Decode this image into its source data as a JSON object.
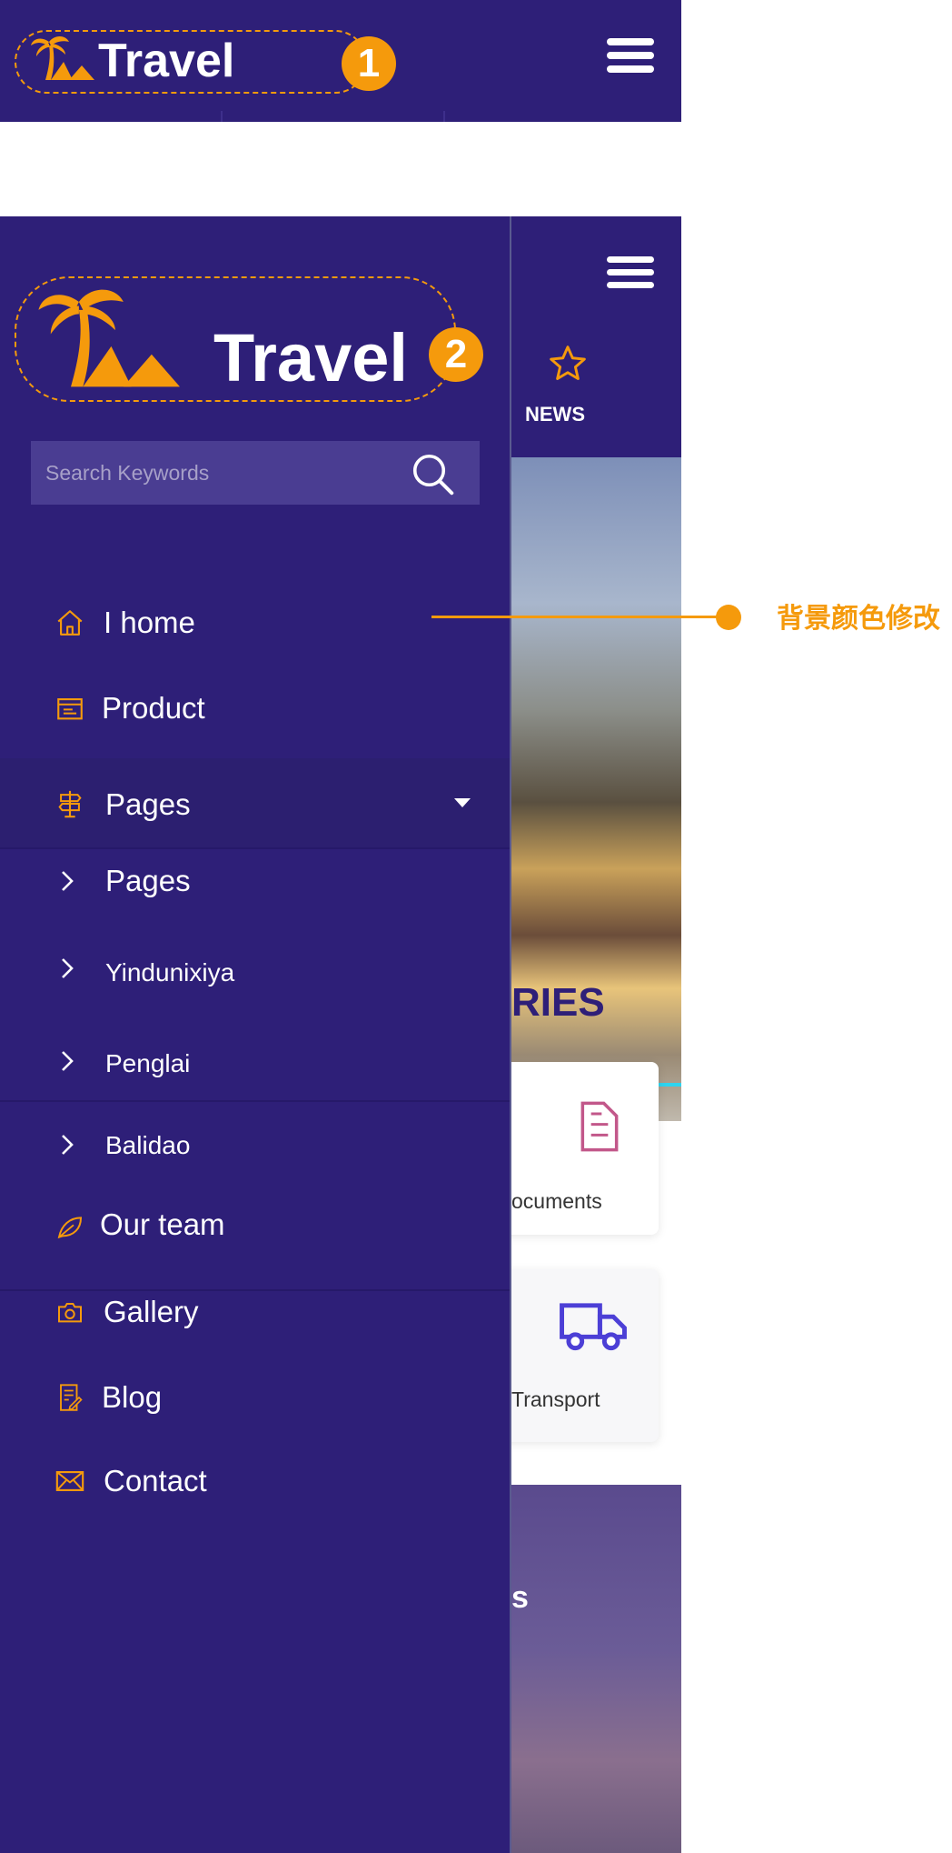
{
  "header": {
    "logo_text": "Travel",
    "badge": "1"
  },
  "drawer": {
    "logo_text": "Travel",
    "badge": "2",
    "search": {
      "placeholder": "Search Keywords"
    },
    "menu": [
      {
        "label": "I home",
        "icon": "home-icon"
      },
      {
        "label": "Product",
        "icon": "product-icon"
      },
      {
        "label": "Pages",
        "icon": "signpost-icon",
        "expanded": true
      },
      {
        "label": "Pages",
        "icon": "chevron-right-icon"
      },
      {
        "label": "Yindunixiya",
        "icon": "chevron-right-icon"
      },
      {
        "label": "Penglai",
        "icon": "chevron-right-icon"
      },
      {
        "label": "Balidao",
        "icon": "chevron-right-icon"
      },
      {
        "label": "Our team",
        "icon": "leaf-icon"
      },
      {
        "label": "Gallery",
        "icon": "camera-icon"
      },
      {
        "label": "Blog",
        "icon": "blog-icon"
      },
      {
        "label": "Contact",
        "icon": "mail-icon"
      }
    ]
  },
  "background_page": {
    "nav_item": "NEWS",
    "section_title_fragment": "RIES",
    "cards": [
      {
        "label": "ocuments",
        "icon": "documents-icon"
      },
      {
        "label": "Transport",
        "icon": "truck-icon"
      }
    ],
    "section2_fragment": "s"
  },
  "annotation": {
    "text": "背景颜色修改",
    "color": "#f59a0c"
  },
  "colors": {
    "primary": "#2e1f78",
    "accent": "#f59a0c",
    "search_bg": "#4a3d92"
  }
}
